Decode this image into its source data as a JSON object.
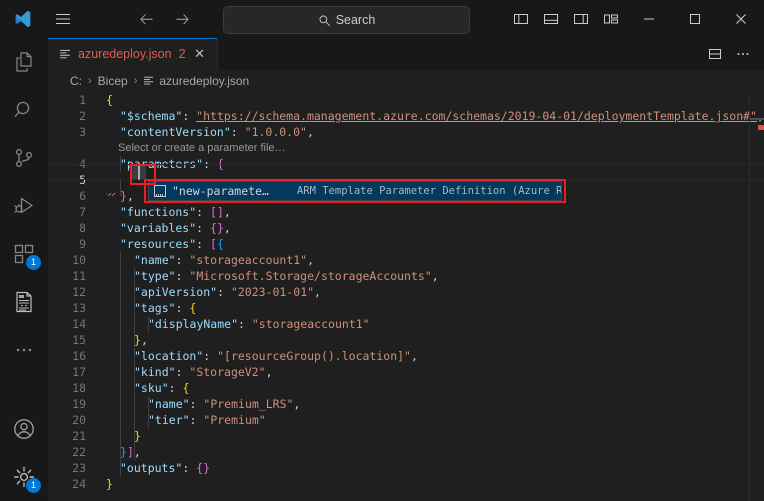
{
  "titlebar": {
    "logo_icon": "vscode-logo-icon",
    "menu_icon": "hamburger-menu-icon",
    "back_icon": "arrow-left-icon",
    "forward_icon": "arrow-right-icon",
    "search": {
      "icon": "search-icon",
      "label": "Search",
      "placeholder": "Search"
    },
    "layout_buttons": [
      {
        "name": "toggle-primary-sidebar",
        "icon": "layout-sidebar-left-icon"
      },
      {
        "name": "toggle-panel",
        "icon": "layout-panel-icon"
      },
      {
        "name": "toggle-secondary-sidebar",
        "icon": "layout-sidebar-right-icon"
      },
      {
        "name": "customize-layout",
        "icon": "layout-customize-icon"
      }
    ],
    "window_buttons": [
      {
        "name": "minimize-window",
        "glyph": "─"
      },
      {
        "name": "maximize-window",
        "glyph": "□"
      },
      {
        "name": "close-window",
        "glyph": "✕"
      }
    ]
  },
  "activitybar": {
    "items": [
      {
        "name": "explorer",
        "icon": "files-icon",
        "badge": ""
      },
      {
        "name": "search",
        "icon": "search-icon",
        "badge": ""
      },
      {
        "name": "source-control",
        "icon": "source-control-icon",
        "badge": ""
      },
      {
        "name": "run-and-debug",
        "icon": "run-debug-icon",
        "badge": ""
      },
      {
        "name": "extensions",
        "icon": "extensions-icon",
        "badge": "1"
      },
      {
        "name": "azure-resource-manager-tools",
        "icon": "template-document-icon",
        "badge": ""
      },
      {
        "name": "additional-views",
        "icon": "ellipsis-icon",
        "badge": ""
      }
    ],
    "bottom_items": [
      {
        "name": "accounts",
        "icon": "account-circle-icon",
        "badge": ""
      },
      {
        "name": "manage-settings",
        "icon": "gear-icon",
        "badge": "1"
      }
    ]
  },
  "tabbar": {
    "tabs": [
      {
        "name": "tab-azuredeploy-json",
        "icon": "json-file-icon",
        "label": "azuredeploy.json",
        "count": "2",
        "close_glyph": "✕",
        "active": true
      }
    ],
    "actions": [
      {
        "name": "split-editor-right",
        "icon": "split-editor-icon"
      },
      {
        "name": "more-editor-actions",
        "icon": "ellipsis-icon"
      }
    ]
  },
  "breadcrumb": {
    "separator": "›",
    "items": [
      {
        "name": "breadcrumb-drive",
        "label": "C:",
        "icon": ""
      },
      {
        "name": "breadcrumb-folder",
        "label": "Bicep",
        "icon": ""
      },
      {
        "name": "breadcrumb-file",
        "label": "azuredeploy.json",
        "icon": "json-file-icon"
      }
    ]
  },
  "editor": {
    "language": "json",
    "active_line": 5,
    "codelens": {
      "line": 4,
      "label": "Select or create a parameter file…"
    },
    "lines": [
      {
        "n": "1",
        "indent": 0,
        "tokens": [
          {
            "t": "{",
            "c": "t-brace1"
          }
        ]
      },
      {
        "n": "2",
        "indent": 1,
        "tokens": [
          {
            "t": "\"$schema\"",
            "c": "t-key"
          },
          {
            "t": ": ",
            "c": "t-punc"
          },
          {
            "t": "\"https://schema.management.azure.com/schemas/2019-04-01/deploymentTemplate.json#\"",
            "c": "t-url"
          },
          {
            "t": ",",
            "c": "t-punc"
          }
        ]
      },
      {
        "n": "3",
        "indent": 1,
        "tokens": [
          {
            "t": "\"contentVersion\"",
            "c": "t-key"
          },
          {
            "t": ": ",
            "c": "t-punc"
          },
          {
            "t": "\"1.0.0.0\"",
            "c": "t-str"
          },
          {
            "t": ",",
            "c": "t-punc"
          }
        ]
      },
      {
        "n": "4",
        "indent": 1,
        "tokens": [
          {
            "t": "\"parameters\"",
            "c": "t-key"
          },
          {
            "t": ": ",
            "c": "t-punc"
          },
          {
            "t": "{",
            "c": "t-brace2"
          }
        ]
      },
      {
        "n": "5",
        "indent": 2,
        "tokens": []
      },
      {
        "n": "6",
        "indent": 1,
        "tokens": [
          {
            "t": "}",
            "c": "t-brace2"
          },
          {
            "t": ",",
            "c": "t-punc"
          }
        ]
      },
      {
        "n": "7",
        "indent": 1,
        "tokens": [
          {
            "t": "\"functions\"",
            "c": "t-key"
          },
          {
            "t": ": ",
            "c": "t-punc"
          },
          {
            "t": "[",
            "c": "t-brace2"
          },
          {
            "t": "]",
            "c": "t-brace2"
          },
          {
            "t": ",",
            "c": "t-punc"
          }
        ]
      },
      {
        "n": "8",
        "indent": 1,
        "tokens": [
          {
            "t": "\"variables\"",
            "c": "t-key"
          },
          {
            "t": ": ",
            "c": "t-punc"
          },
          {
            "t": "{",
            "c": "t-brace2"
          },
          {
            "t": "}",
            "c": "t-brace2"
          },
          {
            "t": ",",
            "c": "t-punc"
          }
        ]
      },
      {
        "n": "9",
        "indent": 1,
        "tokens": [
          {
            "t": "\"resources\"",
            "c": "t-key"
          },
          {
            "t": ": ",
            "c": "t-punc"
          },
          {
            "t": "[",
            "c": "t-brace2"
          },
          {
            "t": "{",
            "c": "t-brace3"
          }
        ]
      },
      {
        "n": "10",
        "indent": 2,
        "tokens": [
          {
            "t": "\"name\"",
            "c": "t-key"
          },
          {
            "t": ": ",
            "c": "t-punc"
          },
          {
            "t": "\"storageaccount1\"",
            "c": "t-str"
          },
          {
            "t": ",",
            "c": "t-punc"
          }
        ]
      },
      {
        "n": "11",
        "indent": 2,
        "tokens": [
          {
            "t": "\"type\"",
            "c": "t-key"
          },
          {
            "t": ": ",
            "c": "t-punc"
          },
          {
            "t": "\"Microsoft.Storage/storageAccounts\"",
            "c": "t-str"
          },
          {
            "t": ",",
            "c": "t-punc"
          }
        ]
      },
      {
        "n": "12",
        "indent": 2,
        "tokens": [
          {
            "t": "\"apiVersion\"",
            "c": "t-key"
          },
          {
            "t": ": ",
            "c": "t-punc"
          },
          {
            "t": "\"2023-01-01\"",
            "c": "t-str"
          },
          {
            "t": ",",
            "c": "t-punc"
          }
        ]
      },
      {
        "n": "13",
        "indent": 2,
        "tokens": [
          {
            "t": "\"tags\"",
            "c": "t-key"
          },
          {
            "t": ": ",
            "c": "t-punc"
          },
          {
            "t": "{",
            "c": "t-brace1"
          }
        ]
      },
      {
        "n": "14",
        "indent": 3,
        "tokens": [
          {
            "t": "\"displayName\"",
            "c": "t-key"
          },
          {
            "t": ": ",
            "c": "t-punc"
          },
          {
            "t": "\"storageaccount1\"",
            "c": "t-str"
          }
        ]
      },
      {
        "n": "15",
        "indent": 2,
        "tokens": [
          {
            "t": "}",
            "c": "t-brace1"
          },
          {
            "t": ",",
            "c": "t-punc"
          }
        ]
      },
      {
        "n": "16",
        "indent": 2,
        "tokens": [
          {
            "t": "\"location\"",
            "c": "t-key"
          },
          {
            "t": ": ",
            "c": "t-punc"
          },
          {
            "t": "\"[resourceGroup().location]\"",
            "c": "t-str"
          },
          {
            "t": ",",
            "c": "t-punc"
          }
        ]
      },
      {
        "n": "17",
        "indent": 2,
        "tokens": [
          {
            "t": "\"kind\"",
            "c": "t-key"
          },
          {
            "t": ": ",
            "c": "t-punc"
          },
          {
            "t": "\"StorageV2\"",
            "c": "t-str"
          },
          {
            "t": ",",
            "c": "t-punc"
          }
        ]
      },
      {
        "n": "18",
        "indent": 2,
        "tokens": [
          {
            "t": "\"sku\"",
            "c": "t-key"
          },
          {
            "t": ": ",
            "c": "t-punc"
          },
          {
            "t": "{",
            "c": "t-brace1"
          }
        ]
      },
      {
        "n": "19",
        "indent": 3,
        "tokens": [
          {
            "t": "\"name\"",
            "c": "t-key"
          },
          {
            "t": ": ",
            "c": "t-punc"
          },
          {
            "t": "\"Premium_LRS\"",
            "c": "t-str"
          },
          {
            "t": ",",
            "c": "t-punc"
          }
        ]
      },
      {
        "n": "20",
        "indent": 3,
        "tokens": [
          {
            "t": "\"tier\"",
            "c": "t-key"
          },
          {
            "t": ": ",
            "c": "t-punc"
          },
          {
            "t": "\"Premium\"",
            "c": "t-str"
          }
        ]
      },
      {
        "n": "21",
        "indent": 2,
        "tokens": [
          {
            "t": "}",
            "c": "t-brace1"
          }
        ]
      },
      {
        "n": "22",
        "indent": 1,
        "tokens": [
          {
            "t": "}",
            "c": "t-brace3"
          },
          {
            "t": "]",
            "c": "t-brace2"
          },
          {
            "t": ",",
            "c": "t-punc"
          }
        ]
      },
      {
        "n": "23",
        "indent": 1,
        "tokens": [
          {
            "t": "\"outputs\"",
            "c": "t-key"
          },
          {
            "t": ": ",
            "c": "t-punc"
          },
          {
            "t": "{",
            "c": "t-brace2"
          },
          {
            "t": "}",
            "c": "t-brace2"
          }
        ]
      },
      {
        "n": "24",
        "indent": 0,
        "tokens": [
          {
            "t": "}",
            "c": "t-brace1"
          }
        ]
      }
    ]
  },
  "suggestion": {
    "icon": "property-snippet-icon",
    "label": "\"new-paramete…",
    "detail": "ARM Template Parameter Definition (Azure Resource…"
  },
  "colors": {
    "accent": "#0078d4",
    "annotation": "#ee1c25",
    "error_text": "#e05f4a",
    "suggest_selected": "#04395e",
    "editor_bg": "#1f1f1f",
    "chrome_bg": "#181818"
  }
}
